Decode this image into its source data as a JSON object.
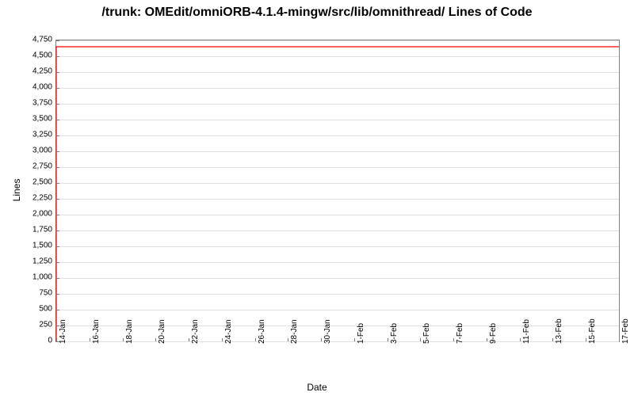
{
  "chart_data": {
    "type": "line",
    "title": "/trunk: OMEdit/omniORB-4.1.4-mingw/src/lib/omnithread/ Lines of Code",
    "xlabel": "Date",
    "ylabel": "Lines",
    "ylim": [
      0,
      4750
    ],
    "y_ticks": [
      0,
      250,
      500,
      750,
      1000,
      1250,
      1500,
      1750,
      2000,
      2250,
      2500,
      2750,
      3000,
      3250,
      3500,
      3750,
      4000,
      4250,
      4500,
      4750
    ],
    "x_ticks": [
      "14-Jan",
      "16-Jan",
      "18-Jan",
      "20-Jan",
      "22-Jan",
      "24-Jan",
      "26-Jan",
      "28-Jan",
      "30-Jan",
      "1-Feb",
      "3-Feb",
      "5-Feb",
      "7-Feb",
      "9-Feb",
      "11-Feb",
      "13-Feb",
      "15-Feb",
      "17-Feb"
    ],
    "series": [
      {
        "name": "Lines of Code",
        "color": "#ff0000",
        "x": [
          "14-Jan",
          "14-Jan",
          "17-Feb"
        ],
        "y": [
          0,
          4650,
          4650
        ]
      }
    ]
  }
}
